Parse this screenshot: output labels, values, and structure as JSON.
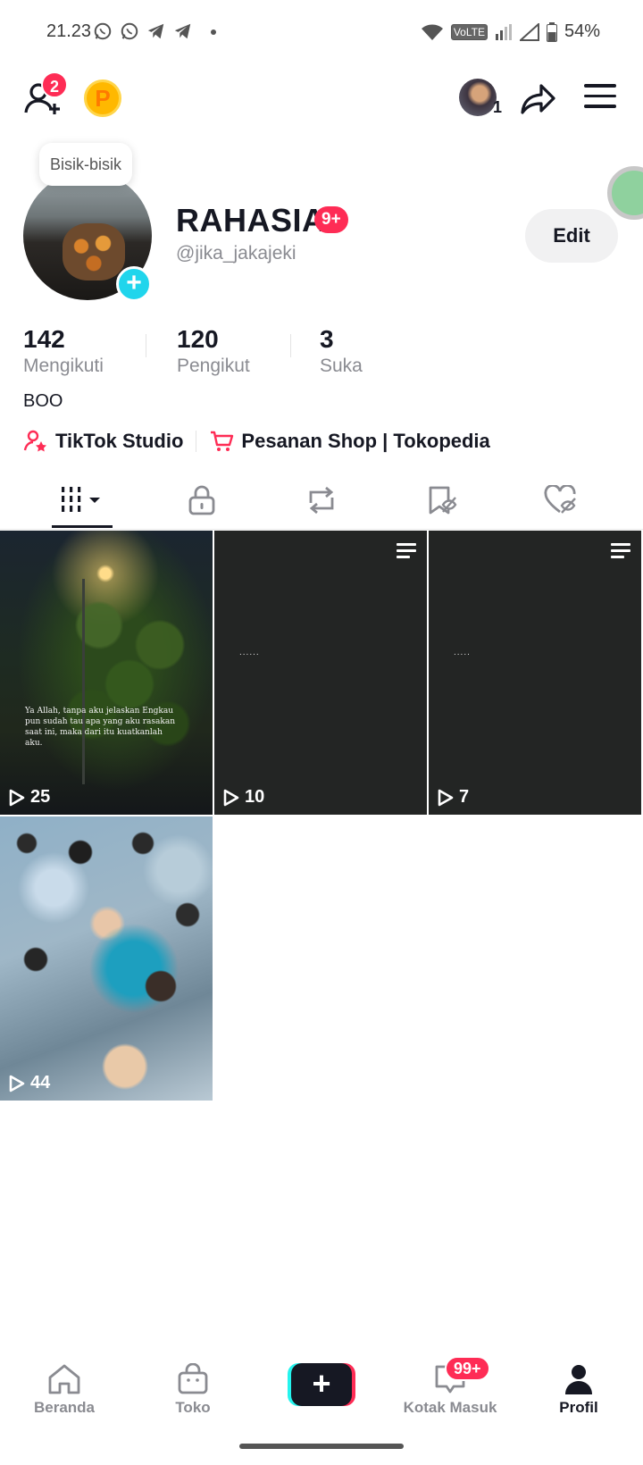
{
  "status_bar": {
    "time": "21.23",
    "volte": "VoLTE",
    "battery": "54%"
  },
  "header": {
    "friend_request_count": "2",
    "coin_label": "P",
    "mini_avatar_count": "1"
  },
  "profile": {
    "note_bubble": "Bisik-bisik",
    "display_name": "RAHASIA",
    "name_badge": "9+",
    "username": "@jika_jakajeki",
    "edit_label": "Edit",
    "stats": [
      {
        "value": "142",
        "label": "Mengikuti"
      },
      {
        "value": "120",
        "label": "Pengikut"
      },
      {
        "value": "3",
        "label": "Suka"
      }
    ],
    "bio": "BOO",
    "links": [
      {
        "label": "TikTok Studio",
        "icon": "person-star-icon"
      },
      {
        "label": "Pesanan Shop | Tokopedia",
        "icon": "cart-icon"
      }
    ]
  },
  "tabs": [
    {
      "name": "videos",
      "icon": "grid-icon",
      "active": true
    },
    {
      "name": "private",
      "icon": "lock-icon"
    },
    {
      "name": "reposts",
      "icon": "repost-icon"
    },
    {
      "name": "favorites",
      "icon": "bookmark-icon"
    },
    {
      "name": "liked",
      "icon": "heart-icon"
    }
  ],
  "videos": [
    {
      "views": "25",
      "caption": "Ya Allah, tanpa aku jelaskan Engkau pun sudah tau apa yang aku rasakan saat ini, maka dari itu kuatkanlah aku."
    },
    {
      "views": "10",
      "overlay_text": "......"
    },
    {
      "views": "7",
      "overlay_text": "....."
    },
    {
      "views": "44"
    }
  ],
  "bottom_nav": {
    "items": [
      {
        "label": "Beranda",
        "icon": "home-icon"
      },
      {
        "label": "Toko",
        "icon": "shop-bag-icon"
      },
      {
        "label": "",
        "icon": "plus-icon"
      },
      {
        "label": "Kotak Masuk",
        "icon": "inbox-icon"
      },
      {
        "label": "Profil",
        "icon": "profile-icon",
        "active": true
      }
    ],
    "create_label": "+",
    "inbox_badge": "99+"
  },
  "colors": {
    "accent": "#fe2c55",
    "cyan": "#25f4ee",
    "text": "#161823",
    "muted": "#8a8b91"
  }
}
